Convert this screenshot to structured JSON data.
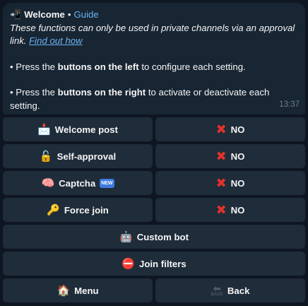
{
  "message": {
    "title": "Welcome",
    "separator": "•",
    "guide_label": "Guide",
    "italic_text": "These functions can only be used in private channels via an approval link.",
    "link_text": "Find out how",
    "para1": {
      "prefix": "• Press the ",
      "bold": "buttons on the left",
      "suffix": " to configure each setting."
    },
    "para2": {
      "prefix": "• Press the ",
      "bold": "buttons on the right",
      "suffix": " to activate or deactivate each setting."
    },
    "time": "13:37",
    "title_icon": "phone-arrow-icon"
  },
  "keyboard": {
    "rows": [
      {
        "left": "Welcome post",
        "left_icon": "envelope-icon",
        "right": "NO"
      },
      {
        "left": "Self-approval",
        "left_icon": "lock-icon",
        "right": "NO"
      },
      {
        "left": "Captcha",
        "left_icon": "brain-icon",
        "left_badge": "NEW",
        "right": "NO"
      },
      {
        "left": "Force join",
        "left_icon": "key-icon",
        "right": "NO"
      }
    ],
    "custom_bot": "Custom bot",
    "join_filters": "Join filters",
    "menu": "Menu",
    "back": "Back",
    "back_badge": "BACK"
  },
  "colors": {
    "background": "#0e1621",
    "bubble": "#182533",
    "button": "#1f2c3a",
    "link": "#6ab3f3",
    "cross": "#e3322c"
  }
}
